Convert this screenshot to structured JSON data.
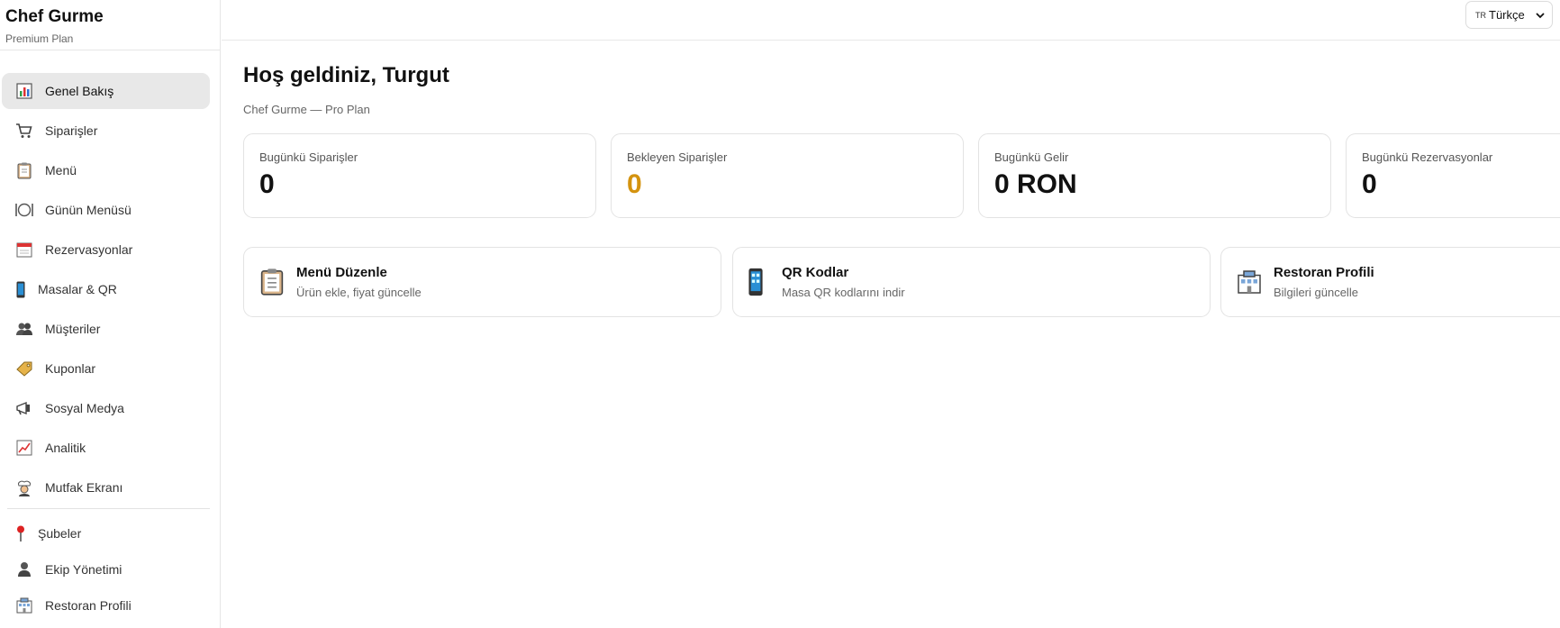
{
  "brand": {
    "name": "Chef Gurme",
    "plan": "Premium Plan"
  },
  "sidebar": {
    "items": [
      {
        "label": "Genel Bakış",
        "icon": "bar-chart-icon",
        "active": true
      },
      {
        "label": "Siparişler",
        "icon": "cart-icon"
      },
      {
        "label": "Menü",
        "icon": "clipboard-icon"
      },
      {
        "label": "Günün Menüsü",
        "icon": "plate-icon"
      },
      {
        "label": "Rezervasyonlar",
        "icon": "calendar-icon"
      },
      {
        "label": "Masalar & QR",
        "icon": "phone-icon"
      },
      {
        "label": "Müşteriler",
        "icon": "users-icon"
      },
      {
        "label": "Kuponlar",
        "icon": "tag-icon"
      },
      {
        "label": "Sosyal Medya",
        "icon": "megaphone-icon"
      },
      {
        "label": "Analitik",
        "icon": "trend-icon"
      },
      {
        "label": "Mutfak Ekranı",
        "icon": "chef-icon"
      }
    ],
    "items2": [
      {
        "label": "Şubeler",
        "icon": "pin-icon"
      },
      {
        "label": "Ekip Yönetimi",
        "icon": "person-icon"
      },
      {
        "label": "Restoran Profili",
        "icon": "building-icon"
      }
    ]
  },
  "topbar": {
    "language_flag": "TR",
    "language": "Türkçe"
  },
  "header": {
    "title": "Hoş geldiniz, Turgut",
    "subtitle": "Chef Gurme — Pro Plan"
  },
  "stats": [
    {
      "label": "Bugünkü Siparişler",
      "value": "0",
      "color": "#111111"
    },
    {
      "label": "Bekleyen Siparişler",
      "value": "0",
      "color": "#d4930f"
    },
    {
      "label": "Bugünkü Gelir",
      "value": "0 RON",
      "color": "#111111"
    },
    {
      "label": "Bugünkü Rezervasyonlar",
      "value": "0",
      "color": "#111111"
    }
  ],
  "quick_actions": [
    {
      "title": "Menü Düzenle",
      "desc": "Ürün ekle, fiyat güncelle",
      "icon": "clipboard-icon"
    },
    {
      "title": "QR Kodlar",
      "desc": "Masa QR kodlarını indir",
      "icon": "phone-icon"
    },
    {
      "title": "Restoran Profili",
      "desc": "Bilgileri güncelle",
      "icon": "building-icon"
    }
  ]
}
